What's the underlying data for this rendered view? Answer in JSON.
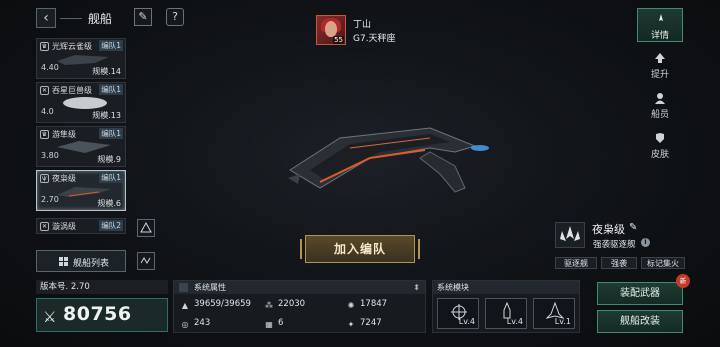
{
  "header": {
    "title": "舰船",
    "back_icon": "back-arrow-icon",
    "edit_icon": "paint-brush-icon",
    "help_icon": "question-icon"
  },
  "captain": {
    "name": "丁山",
    "level": "55",
    "constellation": "G7.天秤座"
  },
  "ship_list": [
    {
      "name": "光辉云雀级",
      "fleet": "编队1",
      "power": "4.40",
      "scale": "规模.14",
      "icon": "crown-icon"
    },
    {
      "name": "吞星巨兽级",
      "fleet": "编队1",
      "power": "4.0",
      "scale": "规模.13",
      "icon": "circle-x-icon"
    },
    {
      "name": "游隼级",
      "fleet": "编队1",
      "power": "3.80",
      "scale": "规模.9",
      "icon": "crown-icon"
    },
    {
      "name": "夜枭级",
      "fleet": "编队1",
      "power": "2.70",
      "scale": "规模.6",
      "icon": "claw-icon",
      "selected": true
    },
    {
      "name": "漩涡级",
      "fleet": "编队2",
      "power": "",
      "scale": "",
      "icon": "circle-x-icon"
    }
  ],
  "list_button": {
    "label": "舰船列表"
  },
  "version": "版本号. 2.70",
  "combat_power": "80756",
  "attributes": {
    "title": "系统属性",
    "items": [
      {
        "icon": "hull-icon",
        "value": "39659/39659"
      },
      {
        "icon": "armor-icon",
        "value": "22030"
      },
      {
        "icon": "shield-icon",
        "value": "17847"
      },
      {
        "icon": "speed-icon",
        "value": "243"
      },
      {
        "icon": "grid-icon",
        "value": "6"
      },
      {
        "icon": "energy-icon",
        "value": "7247"
      }
    ]
  },
  "modules": {
    "title": "系统模块",
    "slots": [
      {
        "icon": "crosshair-icon",
        "level": "Lv.4"
      },
      {
        "icon": "missile-icon",
        "level": "Lv.4"
      },
      {
        "icon": "fighter-icon",
        "level": "Lv.1"
      }
    ]
  },
  "join_fleet": "加入编队",
  "ship_info": {
    "class_name": "夜枭级",
    "type": "强袭驱逐舰",
    "traits": [
      "驱逐舰",
      "强袭",
      "标记集火"
    ]
  },
  "actions": {
    "equip": "装配武器",
    "refit": "舰船改装",
    "new_badge": "新"
  },
  "sidebar": [
    {
      "label": "详情",
      "active": true
    },
    {
      "label": "提升",
      "active": false
    },
    {
      "label": "船员",
      "active": false
    },
    {
      "label": "皮肤",
      "active": false
    }
  ]
}
